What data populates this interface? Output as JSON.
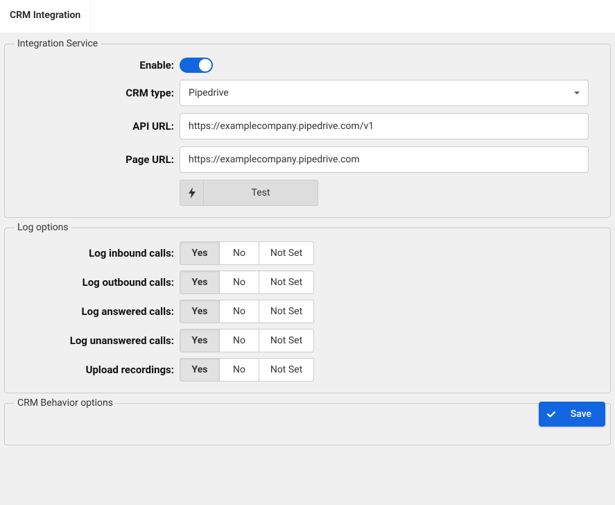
{
  "tab": {
    "label": "CRM Integration"
  },
  "integrationService": {
    "legend": "Integration Service",
    "enable": {
      "label": "Enable:",
      "value": true
    },
    "crmType": {
      "label": "CRM type:",
      "value": "Pipedrive"
    },
    "apiUrl": {
      "label": "API URL:",
      "value": "https://examplecompany.pipedrive.com/v1"
    },
    "pageUrl": {
      "label": "Page URL:",
      "value": "https://examplecompany.pipedrive.com"
    },
    "testLabel": "Test"
  },
  "logOptions": {
    "legend": "Log options",
    "choices": {
      "yes": "Yes",
      "no": "No",
      "notSet": "Not Set"
    },
    "rows": [
      {
        "label": "Log inbound calls:",
        "value": "yes"
      },
      {
        "label": "Log outbound calls:",
        "value": "yes"
      },
      {
        "label": "Log answered calls:",
        "value": "yes"
      },
      {
        "label": "Log unanswered calls:",
        "value": "yes"
      },
      {
        "label": "Upload recordings:",
        "value": "yes"
      }
    ]
  },
  "crmBehavior": {
    "legend": "CRM Behavior options"
  },
  "saveLabel": "Save"
}
